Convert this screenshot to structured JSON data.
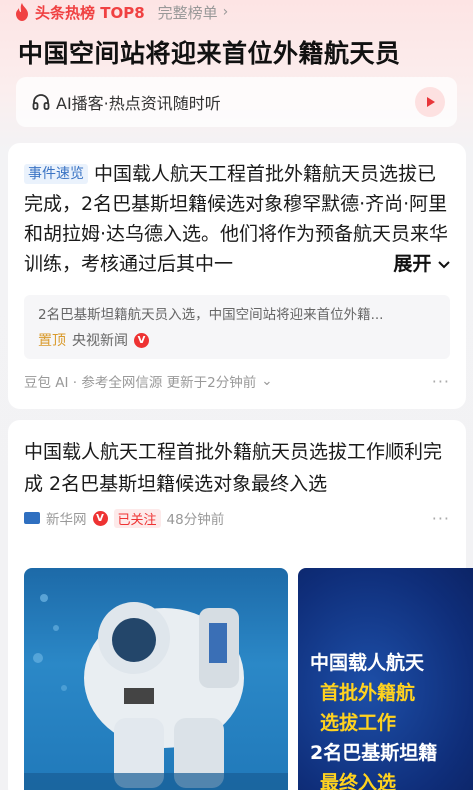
{
  "hot": {
    "title": "头条热榜 TOP8",
    "full_list": "完整榜单",
    "chevron": "›"
  },
  "headline": "中国空间站将迎来首位外籍航天员",
  "ai_bar": {
    "icon": "headphones-icon",
    "text": "AI播客·热点资讯随时听",
    "play_icon": "play-icon"
  },
  "card1": {
    "tag": "事件速览",
    "summary": "中国载人航天工程首批外籍航天员选拔已完成，2名巴基斯坦籍候选对象穆罕默德·齐尚·阿里和胡拉姆·达乌德入选。他们将作为预备航天员来华训练，考核通过后其中一",
    "expand": "展开",
    "sub_text": "2名巴基斯坦籍航天员入选，中国空间站将迎来首位外籍...",
    "pin": "置顶",
    "source": "央视新闻",
    "verified": "V",
    "footer": "豆包 AI · 参考全网信源 更新于2分钟前",
    "footer_chevron": "⌄",
    "more": "···"
  },
  "card2": {
    "title": "中国载人航天工程首批外籍航天员选拔工作顺利完成 2名巴基斯坦籍候选对象最终入选",
    "source": "新华网",
    "verified": "V",
    "followed": "已关注",
    "time": "48分钟前",
    "more": "···",
    "poster_lines": [
      "中国载人航天",
      "首批外籍航",
      "选拔工作",
      "2名巴基斯坦籍",
      "最终入选"
    ]
  },
  "colors": {
    "accent_red": "#f04142",
    "tag_blue": "#3b74c4",
    "poster_yellow": "#ffd21f"
  }
}
